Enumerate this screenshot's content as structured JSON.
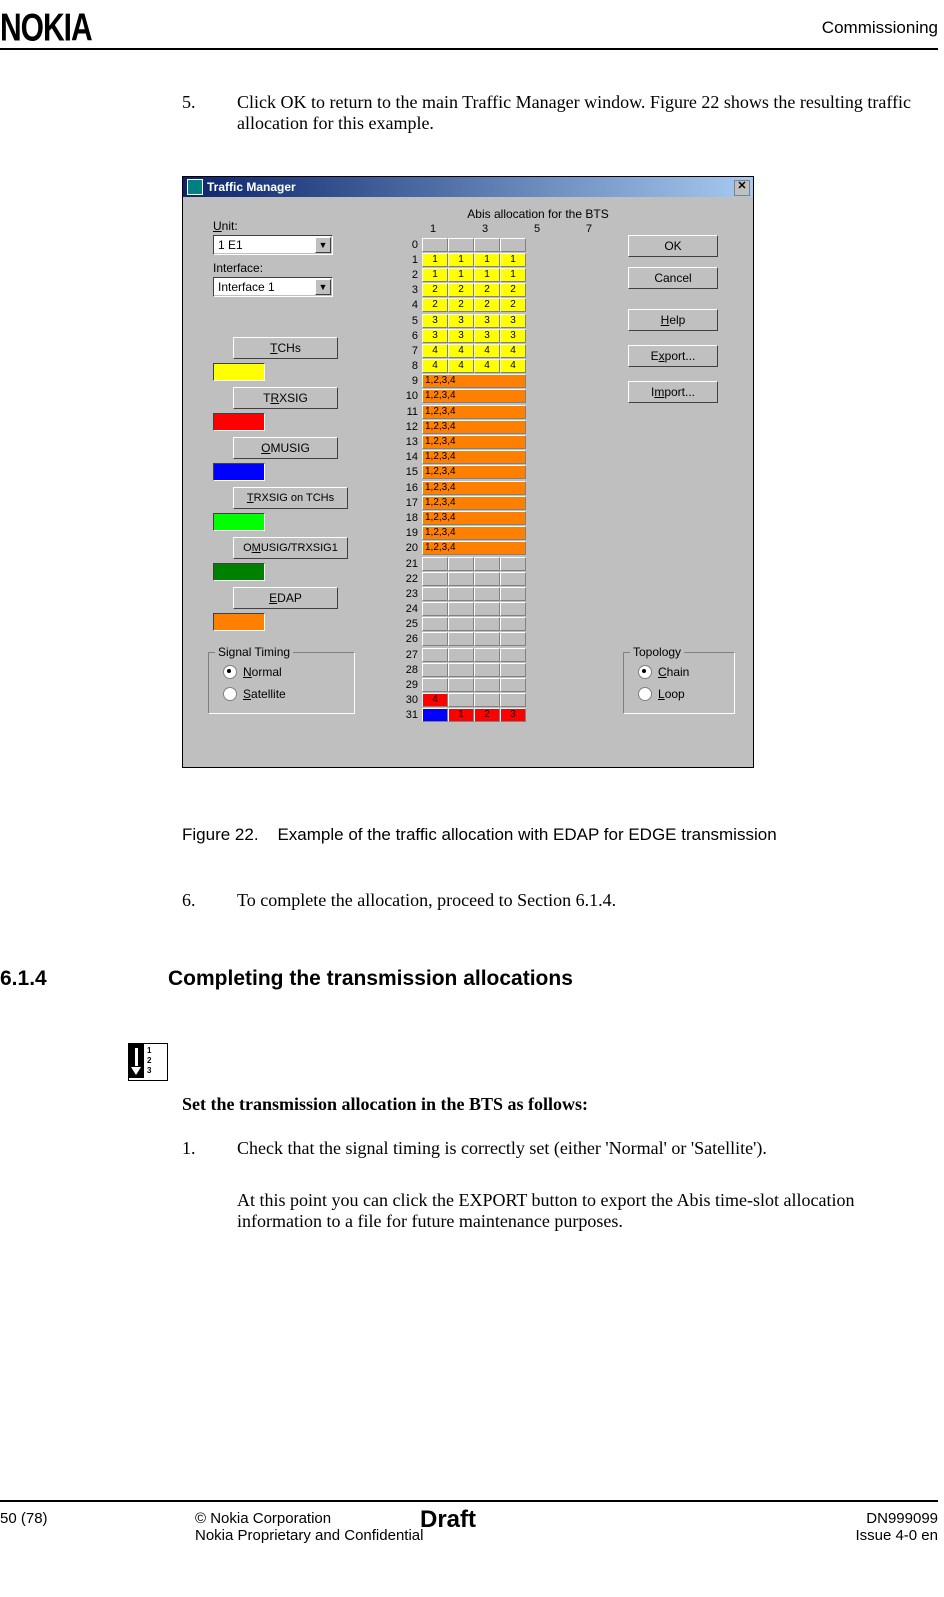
{
  "header": {
    "logo": "NOKIA",
    "right": "Commissioning"
  },
  "step5": {
    "num": "5.",
    "text": "Click OK to return to the main Traffic Manager window. Figure 22 shows the resulting traffic allocation for this example."
  },
  "window": {
    "title": "Traffic Manager",
    "close": "✕",
    "unit_label": "Unit:",
    "unit_value": "1 E1",
    "interface_label": "Interface:",
    "interface_value": "Interface 1",
    "grid_title": "Abis allocation for the BTS",
    "col_heads": [
      "1",
      "",
      "3",
      "",
      "5",
      "",
      "7",
      ""
    ],
    "btn_tchs": "TCHs",
    "btn_trxsig": "TRXSIG",
    "btn_omusig": "OMUSIG",
    "btn_trx_on_tchs": "TRXSIG on TCHs",
    "btn_omu_trx": "OMUSIG/TRXSIG1",
    "btn_edap": "EDAP",
    "signal_box": "Signal Timing",
    "radio_normal": "Normal",
    "radio_sat": "Satellite",
    "topo_box": "Topology",
    "radio_chain": "Chain",
    "radio_loop": "Loop",
    "btn_ok": "OK",
    "btn_cancel": "Cancel",
    "btn_help": "Help",
    "btn_export": "Export...",
    "btn_import": "Import..."
  },
  "grid_rows": [
    {
      "n": "0",
      "cells": [
        {
          "c": "gray"
        },
        {
          "c": "gray"
        },
        {
          "c": "gray"
        },
        {
          "c": "gray"
        }
      ]
    },
    {
      "n": "1",
      "cells": [
        {
          "c": "yellow",
          "t": "1"
        },
        {
          "c": "yellow",
          "t": "1"
        },
        {
          "c": "yellow",
          "t": "1"
        },
        {
          "c": "yellow",
          "t": "1"
        }
      ]
    },
    {
      "n": "2",
      "cells": [
        {
          "c": "yellow",
          "t": "1"
        },
        {
          "c": "yellow",
          "t": "1"
        },
        {
          "c": "yellow",
          "t": "1"
        },
        {
          "c": "yellow",
          "t": "1"
        }
      ]
    },
    {
      "n": "3",
      "cells": [
        {
          "c": "yellow",
          "t": "2"
        },
        {
          "c": "yellow",
          "t": "2"
        },
        {
          "c": "yellow",
          "t": "2"
        },
        {
          "c": "yellow",
          "t": "2"
        }
      ]
    },
    {
      "n": "4",
      "cells": [
        {
          "c": "yellow",
          "t": "2"
        },
        {
          "c": "yellow",
          "t": "2"
        },
        {
          "c": "yellow",
          "t": "2"
        },
        {
          "c": "yellow",
          "t": "2"
        }
      ]
    },
    {
      "n": "5",
      "cells": [
        {
          "c": "yellow",
          "t": "3"
        },
        {
          "c": "yellow",
          "t": "3"
        },
        {
          "c": "yellow",
          "t": "3"
        },
        {
          "c": "yellow",
          "t": "3"
        }
      ]
    },
    {
      "n": "6",
      "cells": [
        {
          "c": "yellow",
          "t": "3"
        },
        {
          "c": "yellow",
          "t": "3"
        },
        {
          "c": "yellow",
          "t": "3"
        },
        {
          "c": "yellow",
          "t": "3"
        }
      ]
    },
    {
      "n": "7",
      "cells": [
        {
          "c": "yellow",
          "t": "4"
        },
        {
          "c": "yellow",
          "t": "4"
        },
        {
          "c": "yellow",
          "t": "4"
        },
        {
          "c": "yellow",
          "t": "4"
        }
      ]
    },
    {
      "n": "8",
      "cells": [
        {
          "c": "yellow",
          "t": "4"
        },
        {
          "c": "yellow",
          "t": "4"
        },
        {
          "c": "yellow",
          "t": "4"
        },
        {
          "c": "yellow",
          "t": "4"
        }
      ]
    },
    {
      "n": "9",
      "merged": true,
      "t": "1,2,3,4",
      "c": "orange"
    },
    {
      "n": "10",
      "merged": true,
      "t": "1,2,3,4",
      "c": "orange"
    },
    {
      "n": "11",
      "merged": true,
      "t": "1,2,3,4",
      "c": "orange"
    },
    {
      "n": "12",
      "merged": true,
      "t": "1,2,3,4",
      "c": "orange"
    },
    {
      "n": "13",
      "merged": true,
      "t": "1,2,3,4",
      "c": "orange"
    },
    {
      "n": "14",
      "merged": true,
      "t": "1,2,3,4",
      "c": "orange"
    },
    {
      "n": "15",
      "merged": true,
      "t": "1,2,3,4",
      "c": "orange"
    },
    {
      "n": "16",
      "merged": true,
      "t": "1,2,3,4",
      "c": "orange"
    },
    {
      "n": "17",
      "merged": true,
      "t": "1,2,3,4",
      "c": "orange"
    },
    {
      "n": "18",
      "merged": true,
      "t": "1,2,3,4",
      "c": "orange"
    },
    {
      "n": "19",
      "merged": true,
      "t": "1,2,3,4",
      "c": "orange"
    },
    {
      "n": "20",
      "merged": true,
      "t": "1,2,3,4",
      "c": "orange"
    },
    {
      "n": "21",
      "cells": [
        {
          "c": "gray"
        },
        {
          "c": "gray"
        },
        {
          "c": "gray"
        },
        {
          "c": "gray"
        }
      ]
    },
    {
      "n": "22",
      "cells": [
        {
          "c": "gray"
        },
        {
          "c": "gray"
        },
        {
          "c": "gray"
        },
        {
          "c": "gray"
        }
      ]
    },
    {
      "n": "23",
      "cells": [
        {
          "c": "gray"
        },
        {
          "c": "gray"
        },
        {
          "c": "gray"
        },
        {
          "c": "gray"
        }
      ]
    },
    {
      "n": "24",
      "cells": [
        {
          "c": "gray"
        },
        {
          "c": "gray"
        },
        {
          "c": "gray"
        },
        {
          "c": "gray"
        }
      ]
    },
    {
      "n": "25",
      "cells": [
        {
          "c": "gray"
        },
        {
          "c": "gray"
        },
        {
          "c": "gray"
        },
        {
          "c": "gray"
        }
      ]
    },
    {
      "n": "26",
      "cells": [
        {
          "c": "gray"
        },
        {
          "c": "gray"
        },
        {
          "c": "gray"
        },
        {
          "c": "gray"
        }
      ]
    },
    {
      "n": "27",
      "cells": [
        {
          "c": "gray"
        },
        {
          "c": "gray"
        },
        {
          "c": "gray"
        },
        {
          "c": "gray"
        }
      ]
    },
    {
      "n": "28",
      "cells": [
        {
          "c": "gray"
        },
        {
          "c": "gray"
        },
        {
          "c": "gray"
        },
        {
          "c": "gray"
        }
      ]
    },
    {
      "n": "29",
      "cells": [
        {
          "c": "gray"
        },
        {
          "c": "gray"
        },
        {
          "c": "gray"
        },
        {
          "c": "gray"
        }
      ]
    },
    {
      "n": "30",
      "cells": [
        {
          "c": "red",
          "t": "4"
        },
        {
          "c": "gray"
        },
        {
          "c": "gray"
        },
        {
          "c": "gray"
        }
      ]
    },
    {
      "n": "31",
      "cells": [
        {
          "c": "blue",
          "t": ""
        },
        {
          "c": "red",
          "t": "1"
        },
        {
          "c": "red",
          "t": "2"
        },
        {
          "c": "red",
          "t": "3"
        }
      ]
    }
  ],
  "figcap": {
    "num": "Figure 22.",
    "text": "Example of the traffic allocation with EDAP for EDGE transmission"
  },
  "step6": {
    "num": "6.",
    "text": "To complete the allocation, proceed to Section 6.1.4."
  },
  "section": {
    "num": "6.1.4",
    "title": "Completing the transmission allocations"
  },
  "proc": {
    "nums": "1\n2\n3"
  },
  "bold_intro": "Set the transmission allocation in the BTS as follows:",
  "step1": {
    "num": "1.",
    "text": "Check that the signal timing is correctly set (either 'Normal' or 'Satellite').",
    "extra": "At this point you can click the EXPORT button to export the Abis time-slot allocation information to a file for future maintenance purposes."
  },
  "footer": {
    "page": "50 (78)",
    "c1": "© Nokia Corporation",
    "c2": "Nokia Proprietary and Confidential",
    "draft": "Draft",
    "r1": "DN999099",
    "r2": "Issue 4-0 en"
  }
}
